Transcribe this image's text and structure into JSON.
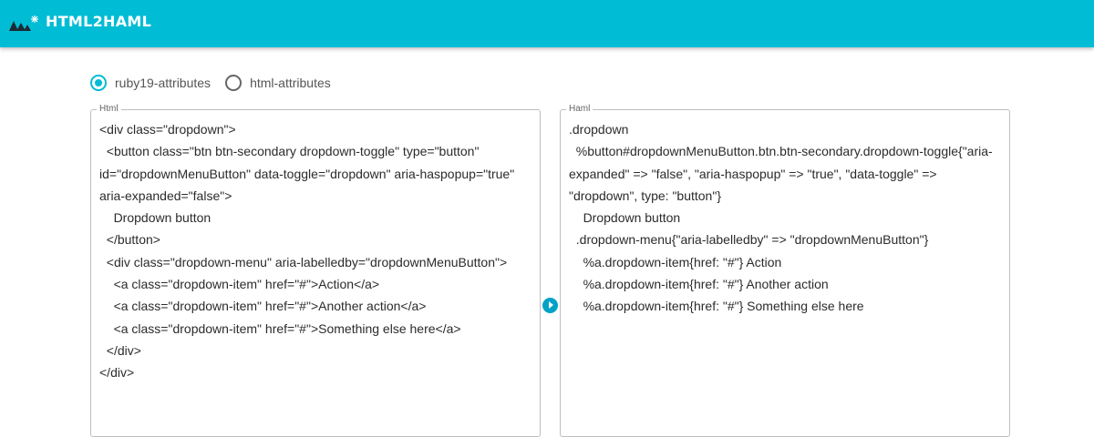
{
  "app": {
    "title": "HTML2HAML"
  },
  "options": {
    "radios": [
      {
        "label": "ruby19-attributes",
        "checked": true
      },
      {
        "label": "html-attributes",
        "checked": false
      }
    ]
  },
  "html_panel": {
    "legend": "Html",
    "code": "<div class=\"dropdown\">\n  <button class=\"btn btn-secondary dropdown-toggle\" type=\"button\" id=\"dropdownMenuButton\" data-toggle=\"dropdown\" aria-haspopup=\"true\" aria-expanded=\"false\">\n    Dropdown button\n  </button>\n  <div class=\"dropdown-menu\" aria-labelledby=\"dropdownMenuButton\">\n    <a class=\"dropdown-item\" href=\"#\">Action</a>\n    <a class=\"dropdown-item\" href=\"#\">Another action</a>\n    <a class=\"dropdown-item\" href=\"#\">Something else here</a>\n  </div>\n</div>"
  },
  "haml_panel": {
    "legend": "Haml",
    "code": ".dropdown\n  %button#dropdownMenuButton.btn.btn-secondary.dropdown-toggle{\"aria-expanded\" => \"false\", \"aria-haspopup\" => \"true\", \"data-toggle\" => \"dropdown\", type: \"button\"}\n    Dropdown button\n  .dropdown-menu{\"aria-labelledby\" => \"dropdownMenuButton\"}\n    %a.dropdown-item{href: \"#\"} Action\n    %a.dropdown-item{href: \"#\"} Another action\n    %a.dropdown-item{href: \"#\"} Something else here"
  },
  "convert_button": {
    "icon": "play-arrow-icon"
  },
  "colors": {
    "accent": "#00bcd4",
    "button": "#00a2c6"
  }
}
